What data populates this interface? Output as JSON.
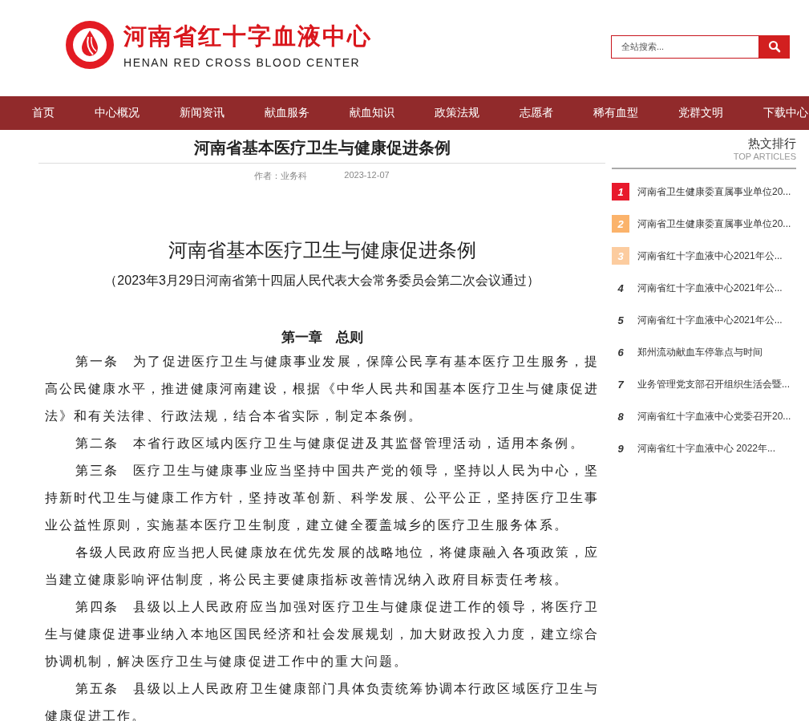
{
  "header": {
    "logo_title": "河南省红十字血液中心",
    "logo_subtitle": "HENAN RED CROSS BLOOD CENTER",
    "search": {
      "placeholder": "全站搜索..."
    }
  },
  "nav": [
    {
      "label": "首页"
    },
    {
      "label": "中心概况"
    },
    {
      "label": "新闻资讯"
    },
    {
      "label": "献血服务"
    },
    {
      "label": "献血知识"
    },
    {
      "label": "政策法规"
    },
    {
      "label": "志愿者"
    },
    {
      "label": "稀有血型"
    },
    {
      "label": "党群文明"
    },
    {
      "label": "下载中心"
    }
  ],
  "article": {
    "title": "河南省基本医疗卫生与健康促进条例",
    "author": "作者：业务科",
    "date": "2023-12-07",
    "doc_title": "河南省基本医疗卫生与健康促进条例",
    "doc_subtitle": "（2023年3月29日河南省第十四届人民代表大会常务委员会第二次会议通过）",
    "chapter": "第一章　总则",
    "paragraphs": [
      "第一条　为了促进医疗卫生与健康事业发展，保障公民享有基本医疗卫生服务，提高公民健康水平，推进健康河南建设，根据《中华人民共和国基本医疗卫生与健康促进法》和有关法律、行政法规，结合本省实际，制定本条例。",
      "第二条　本省行政区域内医疗卫生与健康促进及其监督管理活动，适用本条例。",
      "第三条　医疗卫生与健康事业应当坚持中国共产党的领导，坚持以人民为中心，坚持新时代卫生与健康工作方针，坚持改革创新、科学发展、公平公正，坚持医疗卫生事业公益性原则，实施基本医疗卫生制度，建立健全覆盖城乡的医疗卫生服务体系。",
      "各级人民政府应当把人民健康放在优先发展的战略地位，将健康融入各项政策，应当建立健康影响评估制度，将公民主要健康指标改善情况纳入政府目标责任考核。",
      "第四条　县级以上人民政府应当加强对医疗卫生与健康促进工作的领导，将医疗卫生与健康促进事业纳入本地区国民经济和社会发展规划，加大财政投入力度，建立综合协调机制，解决医疗卫生与健康促进工作中的重大问题。",
      "第五条　县级以上人民政府卫生健康部门具体负责统筹协调本行政区域医疗卫生与健康促进工作。"
    ]
  },
  "sidebar": {
    "title": "热文排行",
    "subtitle": "TOP ARTICLES",
    "items": [
      {
        "rank": "1",
        "title": "河南省卫生健康委直属事业单位20...",
        "color": "#e8192c"
      },
      {
        "rank": "2",
        "title": "河南省卫生健康委直属事业单位20...",
        "color": "#fbb36b"
      },
      {
        "rank": "3",
        "title": "河南省红十字血液中心2021年公...",
        "color": "#fccc9f"
      },
      {
        "rank": "4",
        "title": "河南省红十字血液中心2021年公..."
      },
      {
        "rank": "5",
        "title": "河南省红十字血液中心2021年公..."
      },
      {
        "rank": "6",
        "title": "郑州流动献血车停靠点与时间"
      },
      {
        "rank": "7",
        "title": "业务管理党支部召开组织生活会暨..."
      },
      {
        "rank": "8",
        "title": "河南省红十字血液中心党委召开20..."
      },
      {
        "rank": "9",
        "title": "河南省红十字血液中心 2022年..."
      }
    ]
  }
}
